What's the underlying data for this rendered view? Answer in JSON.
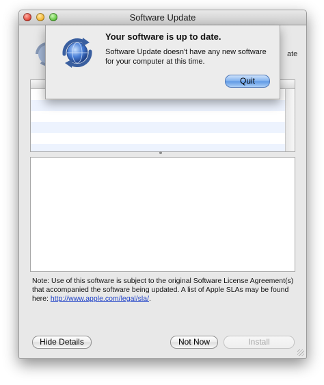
{
  "window": {
    "title": "Software Update"
  },
  "background": {
    "partial_label": "ate"
  },
  "sheet": {
    "title": "Your software is up to date.",
    "message": "Software Update doesn't have any new software for your computer at this time.",
    "quit_label": "Quit",
    "icon": "software-update-icon"
  },
  "updates_list": {
    "row_count": 6
  },
  "footer": {
    "note_text": "Note: Use of this software is subject to the original Software License Agreement(s) that accompanied the software being updated. A list of Apple SLAs may be found here:",
    "link_text": "http://www.apple.com/legal/sla/",
    "link_suffix": "."
  },
  "buttons": {
    "hide_details": "Hide Details",
    "not_now": "Not Now",
    "install": "Install"
  },
  "colors": {
    "default_button": "#6aa2e8",
    "row_stripe": "#edf3fe",
    "link": "#1c3fc7"
  }
}
